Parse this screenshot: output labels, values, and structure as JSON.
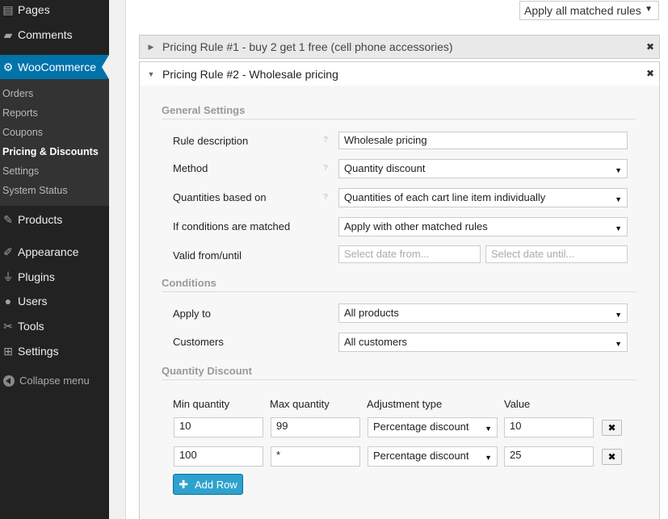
{
  "sidebar": {
    "items": [
      {
        "label": "Pages",
        "icon": "pages-icon"
      },
      {
        "label": "Comments",
        "icon": "comments-icon"
      },
      {
        "label": "WooCommerce",
        "icon": "gear-icon"
      },
      {
        "label": "Products",
        "icon": "pin-icon"
      },
      {
        "label": "Appearance",
        "icon": "brush-icon"
      },
      {
        "label": "Plugins",
        "icon": "plug-icon"
      },
      {
        "label": "Users",
        "icon": "user-icon"
      },
      {
        "label": "Tools",
        "icon": "wrench-icon"
      },
      {
        "label": "Settings",
        "icon": "sliders-icon"
      }
    ],
    "submenu": [
      "Orders",
      "Reports",
      "Coupons",
      "Pricing & Discounts",
      "Settings",
      "System Status"
    ],
    "collapse_label": "Collapse menu"
  },
  "top_select": {
    "value": "Apply all matched rules"
  },
  "rules": {
    "rule1_title": "Pricing Rule #1 - buy 2 get 1 free (cell phone accessories)",
    "rule2_title": "Pricing Rule #2 - Wholesale pricing"
  },
  "general": {
    "title": "General Settings",
    "rule_description_label": "Rule description",
    "rule_description_value": "Wholesale pricing",
    "method_label": "Method",
    "method_value": "Quantity discount",
    "quantities_label": "Quantities based on",
    "quantities_value": "Quantities of each cart line item individually",
    "conditions_matched_label": "If conditions are matched",
    "conditions_matched_value": "Apply with other matched rules",
    "valid_label": "Valid from/until",
    "date_from_placeholder": "Select date from...",
    "date_until_placeholder": "Select date until...",
    "help_mark": "?"
  },
  "conditions": {
    "title": "Conditions",
    "apply_to_label": "Apply to",
    "apply_to_value": "All products",
    "customers_label": "Customers",
    "customers_value": "All customers"
  },
  "quantity_discount": {
    "title": "Quantity Discount",
    "headers": [
      "Min quantity",
      "Max quantity",
      "Adjustment type",
      "Value"
    ],
    "rows": [
      {
        "min": "10",
        "max": "99",
        "type": "Percentage discount",
        "value": "10"
      },
      {
        "min": "100",
        "max": "*",
        "type": "Percentage discount",
        "value": "25"
      }
    ],
    "add_row_label": "Add Row"
  }
}
